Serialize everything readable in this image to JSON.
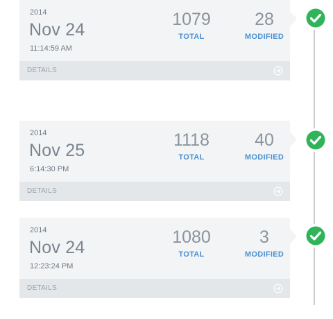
{
  "entries": [
    {
      "year": "2014",
      "date": "Nov 25",
      "time": "6:14:30 PM",
      "total_value": "1118",
      "total_label": "TOTAL",
      "modified_value": "40",
      "modified_label": "MODIFIED",
      "details_label": "DETAILS",
      "status": "success"
    },
    {
      "year": "2014",
      "date": "Nov 24",
      "time": "12:23:24 PM",
      "total_value": "1080",
      "total_label": "TOTAL",
      "modified_value": "3",
      "modified_label": "MODIFIED",
      "details_label": "DETAILS",
      "status": "success"
    },
    {
      "year": "2014",
      "date": "Nov 24",
      "time": "11:14:59 AM",
      "total_value": "1079",
      "total_label": "TOTAL",
      "modified_value": "28",
      "modified_label": "MODIFIED",
      "details_label": "DETAILS",
      "status": "success"
    }
  ],
  "icons": {
    "status": "check-circle-icon",
    "details": "arrow-circle-right-icon"
  },
  "colors": {
    "success": "#2fb45a",
    "accent": "#4a90d0",
    "card": "#f3f4f5",
    "footer": "#e4e7ea"
  }
}
